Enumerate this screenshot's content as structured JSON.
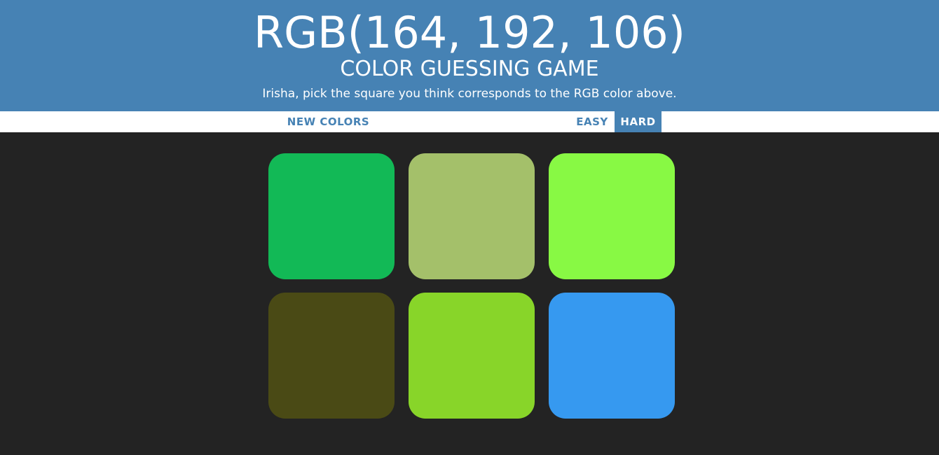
{
  "header": {
    "rgb_display": "RGB(164, 192, 106)",
    "title": "COLOR GUESSING GAME",
    "instructions": "Irisha, pick the square you think corresponds to the RGB color above."
  },
  "controls": {
    "new_colors_label": "NEW COLORS",
    "easy_label": "EASY",
    "hard_label": "HARD",
    "selected_mode": "hard"
  },
  "colors": {
    "accent": "#4682b4",
    "background": "#232323"
  },
  "squares": [
    {
      "color": "#12b956"
    },
    {
      "color": "#a4c06a"
    },
    {
      "color": "#88f944"
    },
    {
      "color": "#4a4a15"
    },
    {
      "color": "#88d529"
    },
    {
      "color": "#3699f0"
    }
  ]
}
